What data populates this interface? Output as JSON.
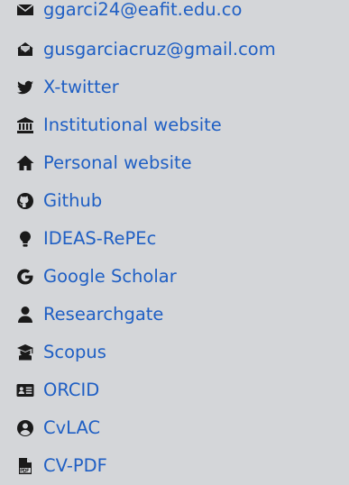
{
  "links": [
    {
      "name": "email-eafit-link",
      "icon": "envelope-icon",
      "label": "ggarci24@eafit.edu.co"
    },
    {
      "name": "email-gmail-link",
      "icon": "envelope-open-icon",
      "label": "gusgarciacruz@gmail.com"
    },
    {
      "name": "twitter-link",
      "icon": "twitter-bird-icon",
      "label": "X-twitter"
    },
    {
      "name": "institutional-website-link",
      "icon": "institution-icon",
      "label": "Institutional website"
    },
    {
      "name": "personal-website-link",
      "icon": "home-icon",
      "label": "Personal website"
    },
    {
      "name": "github-link",
      "icon": "github-icon",
      "label": "Github"
    },
    {
      "name": "ideas-repec-link",
      "icon": "lightbulb-icon",
      "label": "IDEAS-RePEc"
    },
    {
      "name": "google-scholar-link",
      "icon": "google-icon",
      "label": "Google Scholar"
    },
    {
      "name": "researchgate-link",
      "icon": "user-icon",
      "label": "Researchgate"
    },
    {
      "name": "scopus-link",
      "icon": "graduation-cap-icon",
      "label": "Scopus"
    },
    {
      "name": "orcid-link",
      "icon": "id-card-icon",
      "label": "ORCID"
    },
    {
      "name": "cvlac-link",
      "icon": "user-circle-icon",
      "label": "CvLAC"
    },
    {
      "name": "cv-pdf-link",
      "icon": "pdf-file-icon",
      "label": "CV-PDF"
    }
  ],
  "colors": {
    "link": "#1f5fc4",
    "icon": "#1a1a1a",
    "background": "#d4d6d9"
  }
}
